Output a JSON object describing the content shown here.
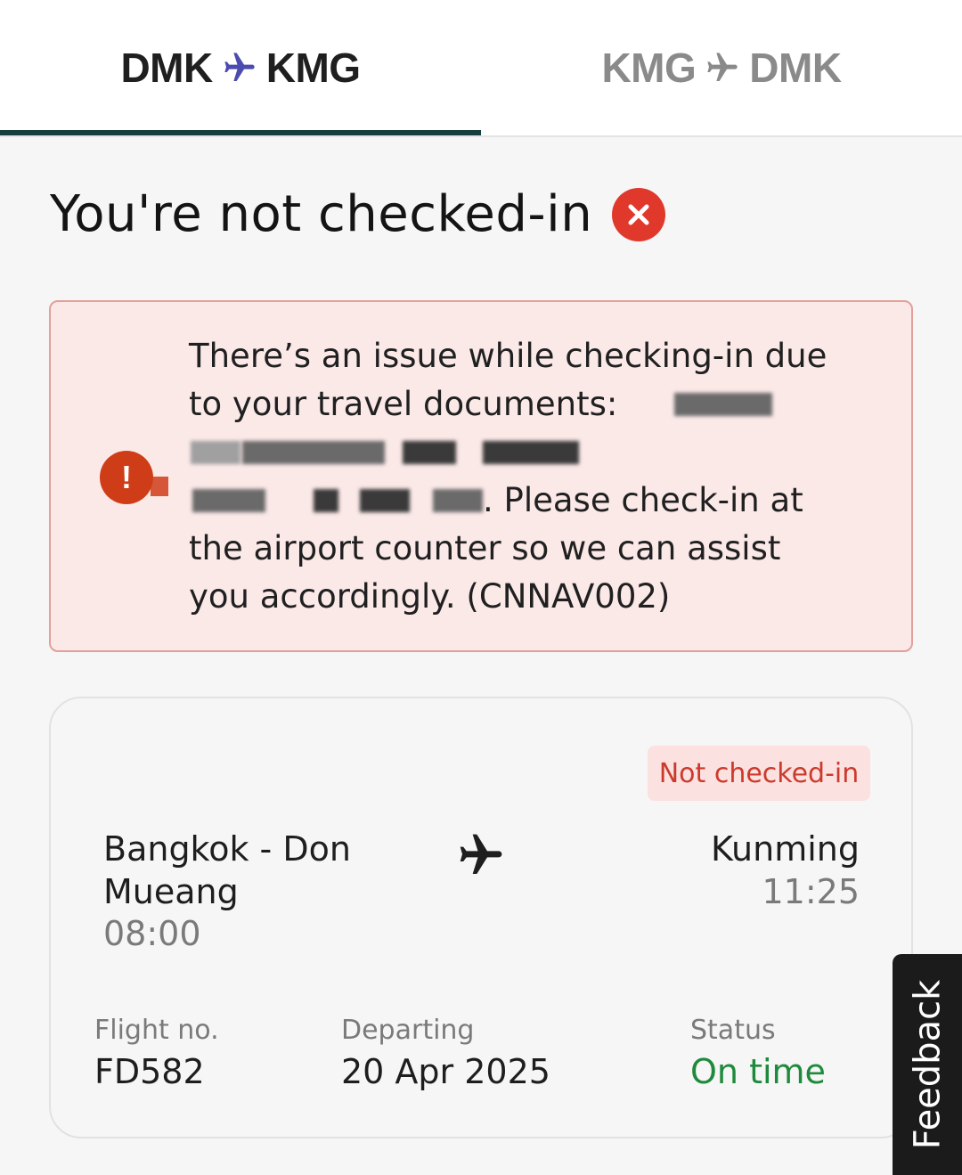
{
  "tabs": [
    {
      "from": "DMK",
      "to": "KMG",
      "active": true
    },
    {
      "from": "KMG",
      "to": "DMK",
      "active": false
    }
  ],
  "colors": {
    "active_plane": "#4b4bb0",
    "inactive_plane": "#8a8a8a",
    "tab_underline": "#173e3f",
    "error_red": "#e1382c"
  },
  "status_heading": {
    "text": "You're not checked-in",
    "icon": "close-icon"
  },
  "alert": {
    "icon": "exclamation-icon",
    "line1": "There’s an issue while checking-in due",
    "line2": "to your travel documents:",
    "line4_tail": ". Please check-in at",
    "line5": "the airport counter so we can assist",
    "line6": "you accordingly. (CNNAV002)"
  },
  "flight": {
    "badge": "Not checked-in",
    "origin": "Bangkok - Don Mueang",
    "origin_time": "08:00",
    "destination": "Kunming",
    "destination_time": "11:25",
    "route_icon": "airplane-icon",
    "flight_no_label": "Flight no.",
    "flight_no": "FD582",
    "departing_label": "Departing",
    "departing": "20 Apr 2025",
    "status_label": "Status",
    "status": "On time"
  },
  "feedback_label": "Feedback"
}
